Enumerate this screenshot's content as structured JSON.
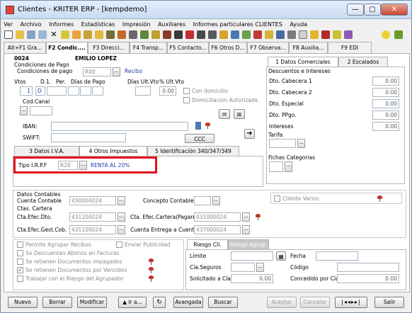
{
  "window": {
    "title": "Clientes - KRITER ERP - [kempdemo]",
    "controls": [
      "—",
      "▢",
      "✕"
    ]
  },
  "menu": [
    "Ver",
    "Archivo",
    "Informes",
    "Estadísticas",
    "Impresión",
    "Auxiliares",
    "Informes particulares CLIENTES",
    "Ayuda"
  ],
  "tabs": [
    "Alt+F1 Gra...",
    "F2 Condic....",
    "F3 Direcci...",
    "F4 Transp...",
    "F5 Contacto...",
    "F6 Otros D...",
    "F7 Observa...",
    "F8 Auxilia...",
    "F9 EDI"
  ],
  "active_tab": "F2 Condic....",
  "header": {
    "code": "0024",
    "name": "EMILIO LOPEZ"
  },
  "left": {
    "cond_section": "Condiciones de Pago",
    "cond_label": "Condiciones de pago",
    "cond_value": "R00",
    "cond_desc": "Recibo",
    "cols": [
      "Vtos",
      "D.1.",
      "Per.",
      "Días de Pago",
      "Días Ult.Vto",
      "% Ult.Vto"
    ],
    "vtos": "1",
    "d1": "D",
    "pct": "0.00",
    "codcanal": "Cod.Canal",
    "domicilio": "Con domicilio",
    "domiciliacion": "Domiciliacion Autorizada",
    "iban": "IBAN:",
    "swift": "SWIFT:",
    "ccc": "CCC",
    "subtabs": [
      "3 Datos I.V.A.",
      "4 Otros Impuestos",
      "5 Identificación 340/347/349"
    ],
    "irpf_label": "Tipo I.R.P.F",
    "irpf_code": "R20",
    "irpf_desc": "RENTA AL 20%"
  },
  "right": {
    "tabs": [
      "1 Datos Comerciales",
      "2 Escalados"
    ],
    "section": "Descuentos e Intereses",
    "rows": [
      {
        "label": "Dto. Cabecera 1",
        "value": "0.00"
      },
      {
        "label": "Dto. Cabecera 2",
        "value": "0.00"
      },
      {
        "label": "Dto. Especial",
        "value": "0.00"
      },
      {
        "label": "Dto. PPgo.",
        "value": "0.00"
      },
      {
        "label": "Intereses",
        "value": "0.00"
      }
    ],
    "tarifa": "Tarifa",
    "fichas": "Fichas Categorias"
  },
  "contables": {
    "section": "Datos Contables",
    "cuenta_label": "Cuenta Contable",
    "cuenta_value": "430000024",
    "concepto": "Concepto Contable",
    "cliente_varios": "Cliente Varios",
    "cartera": "Ctas. Cartera",
    "efec_dto_label": "Cta.Efec.Dto.",
    "efec_dto_value": "431200024",
    "efec_gest_label": "Cta.Efec.Gest.Cob.",
    "efec_gest_value": "431100024",
    "cartera_pag_label": "Cta. Efec.Cartera(Pagaré)",
    "cartera_pag_value": "431000024",
    "entrega_label": "Cuenta Entrega a Cuenta",
    "entrega_value": "437000024"
  },
  "options": {
    "permite": "Permite Agrupar Recibos.",
    "enviar": "Enviar Publicidad",
    "abonos": "Se Descuentan Abonos en Facturas.",
    "impagados": "Se retienen Documentos impagados",
    "vencidos": "Se retienen Documentos por Vencidos",
    "trabajar": "Trabajar con el Riesgo del Agrupador"
  },
  "riesgo": {
    "tabs": [
      "Riesgo Cli.",
      "Riesgo Agrup."
    ],
    "limite": "Límite",
    "fecha": "Fecha",
    "seguros": "Cía.Seguros",
    "codigo": "Código",
    "solicitado": "Solicitado a Cía",
    "solicitado_val": "0.00",
    "concedido": "Concedido por Cía",
    "concedido_val": "0.00"
  },
  "bottom": [
    "Nuevo",
    "Borrar",
    "Modificar",
    "▲ Ir a...",
    "Avangada",
    "Buscar",
    "Aceptar",
    "Cancelar",
    "Salir"
  ]
}
